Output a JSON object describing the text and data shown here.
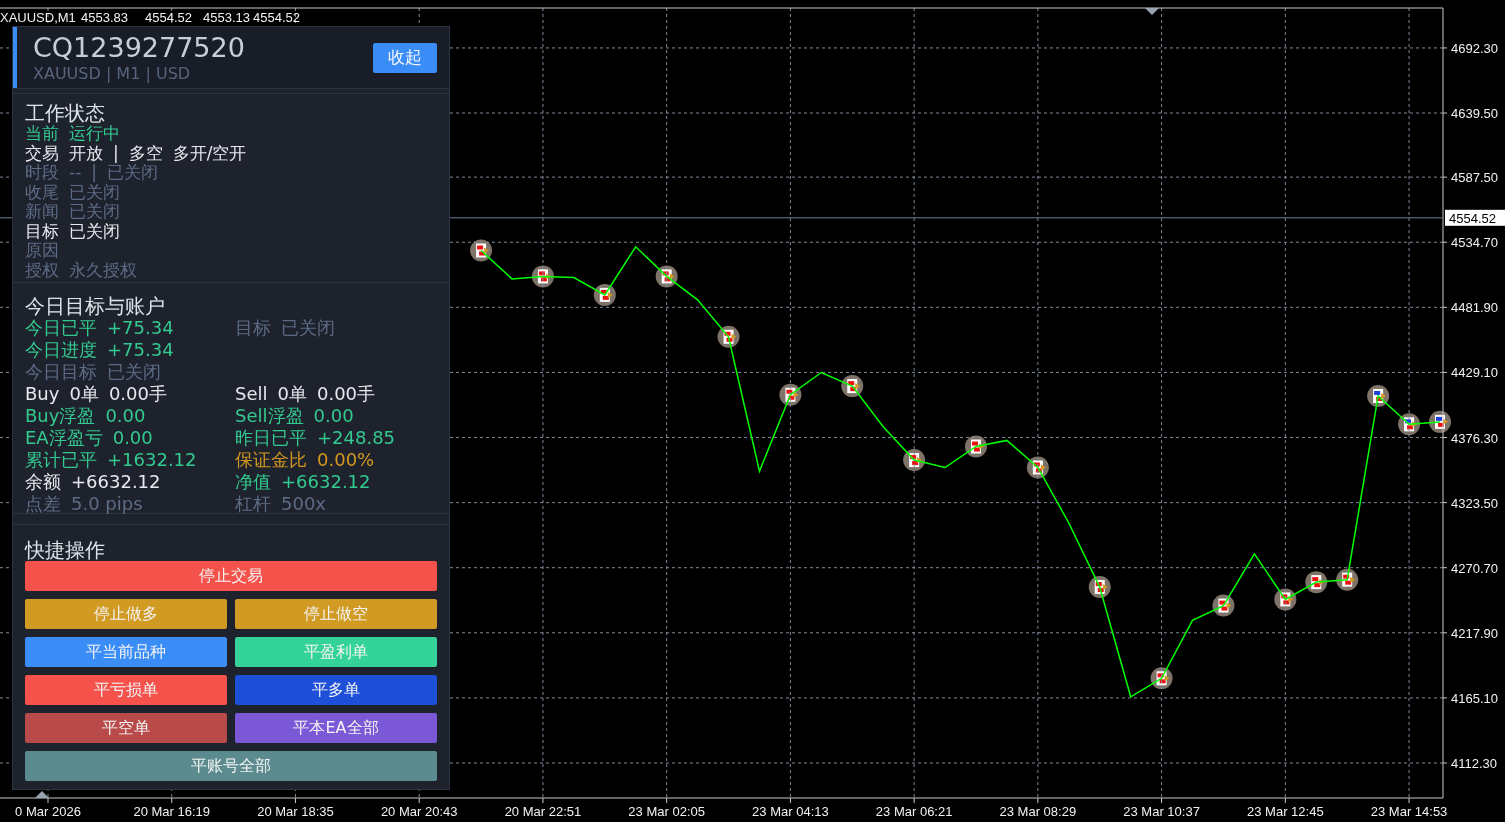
{
  "chart_header": {
    "quotes": [
      "4553.83",
      "4554.52",
      "4553.13",
      "4554.52"
    ]
  },
  "chart_data": {
    "type": "line",
    "grid": true,
    "ylim": [
      4083.9,
      4724.7
    ],
    "categories": [
      "0 Mar 2026",
      null,
      null,
      null,
      "20 Mar 16:19",
      null,
      null,
      null,
      "20 Mar 18:35",
      null,
      null,
      null,
      "20 Mar 20:43",
      null,
      null,
      null,
      "20 Mar 22:51",
      null,
      null,
      null,
      "23 Mar 02:05",
      null,
      null,
      null,
      "23 Mar 04:13",
      null,
      null,
      null,
      "23 Mar 06:21",
      null,
      null,
      null,
      "23 Mar 08:29",
      null,
      null,
      null,
      "23 Mar 10:37",
      null,
      null,
      null,
      "23 Mar 12:45",
      null,
      null,
      null,
      "23 Mar 14:53",
      null
    ],
    "yticks": [
      {
        "value": 4692.3,
        "label": "4692.30"
      },
      {
        "value": 4639.5,
        "label": "4639.50"
      },
      {
        "value": 4587.5,
        "label": "4587.50"
      },
      {
        "value": 4534.7,
        "label": "4534.70"
      },
      {
        "value": 4481.9,
        "label": "4481.90"
      },
      {
        "value": 4429.1,
        "label": "4429.10"
      },
      {
        "value": 4376.3,
        "label": "4376.30"
      },
      {
        "value": 4323.5,
        "label": "4323.50"
      },
      {
        "value": 4270.7,
        "label": "4270.70"
      },
      {
        "value": 4217.9,
        "label": "4217.90"
      },
      {
        "value": 4165.1,
        "label": "4165.10"
      },
      {
        "value": 4112.3,
        "label": "4112.30"
      }
    ],
    "series": [
      {
        "name": "XAUUSD,M1",
        "color": "#00ff00",
        "values": [
          null,
          null,
          null,
          null,
          null,
          null,
          null,
          null,
          null,
          null,
          null,
          null,
          null,
          null,
          4528,
          4505,
          4507,
          4506,
          4492,
          4531,
          4507,
          4488,
          4458,
          4349,
          4411,
          4429,
          4418,
          4385,
          4358,
          4352,
          4369,
          4374,
          4352,
          4307,
          4255,
          4166,
          4181,
          4228,
          4240,
          4282,
          4245,
          4259,
          4261,
          4410,
          4387,
          4389
        ]
      }
    ]
  },
  "current_price": {
    "label": "4554.52"
  },
  "panel": {
    "title": "CQ1239277520",
    "subtitle": "XAUUSD | M1 | USD",
    "collapse_button": "收起",
    "status": {
      "heading": "工作状态",
      "rows": [
        {
          "label": "当前",
          "values": [
            "运行中"
          ],
          "color": "#34c98e"
        },
        {
          "label": "交易",
          "values": [
            "开放",
            "|",
            "多空",
            "多开/空开"
          ],
          "color": "#e6e9ee"
        },
        {
          "label": "时段",
          "values": [
            "--",
            "|",
            "已关闭"
          ],
          "color": "#5d6b85"
        },
        {
          "label": "收尾",
          "values": [
            "已关闭"
          ],
          "color": "#5d6b85"
        },
        {
          "label": "新闻",
          "values": [
            "已关闭"
          ],
          "color": "#5d6b85"
        },
        {
          "label": "目标",
          "values": [
            "已关闭"
          ],
          "color": "#e6e9ee"
        },
        {
          "label": "原因",
          "values": [],
          "color": "#5d6b85"
        },
        {
          "label": "授权",
          "values": [
            "永久授权"
          ],
          "color": "#5d6b85"
        }
      ]
    },
    "account": {
      "heading": "今日目标与账户",
      "rows": [
        {
          "left": {
            "label": "今日已平",
            "values": [
              "+75.34"
            ],
            "color": "#34c98e"
          },
          "right": {
            "label": "目标",
            "values": [
              "已关闭"
            ],
            "color": "#5d6b85"
          }
        },
        {
          "left": {
            "label": "今日进度",
            "values": [
              "+75.34"
            ],
            "color": "#34c98e"
          }
        },
        {
          "left": {
            "label": "今日目标",
            "values": [
              "已关闭"
            ],
            "color": "#5d6b85"
          }
        },
        {
          "left": {
            "label": "Buy",
            "values": [
              "0单",
              "0.00手"
            ],
            "color": "#e6e9ee"
          },
          "right": {
            "label": "Sell",
            "values": [
              "0单",
              "0.00手"
            ],
            "color": "#e6e9ee"
          }
        },
        {
          "left": {
            "label": "Buy浮盈",
            "values": [
              "0.00"
            ],
            "color": "#34c98e"
          },
          "right": {
            "label": "Sell浮盈",
            "values": [
              "0.00"
            ],
            "color": "#34c98e"
          }
        },
        {
          "left": {
            "label": "EA浮盈亏",
            "values": [
              "0.00"
            ],
            "color": "#34c98e"
          },
          "right": {
            "label": "昨日已平",
            "values": [
              "+248.85"
            ],
            "color": "#34c98e"
          }
        },
        {
          "left": {
            "label": "累计已平",
            "values": [
              "+1632.12"
            ],
            "color": "#34c98e"
          },
          "right": {
            "label": "保证金比",
            "values": [
              "0.00%"
            ],
            "color": "#d4981f"
          }
        },
        {
          "left": {
            "label": "余额",
            "values": [
              "+6632.12"
            ],
            "color": "#e6e9ee"
          },
          "right": {
            "label": "净值",
            "values": [
              "+6632.12"
            ],
            "color": "#34c98e"
          }
        },
        {
          "left": {
            "label": "点差",
            "values": [
              "5.0 pips"
            ],
            "color": "#5d6b85"
          },
          "right": {
            "label": "杠杆",
            "values": [
              "500x"
            ],
            "color": "#5d6b85"
          }
        }
      ]
    },
    "actions": {
      "heading": "快捷操作",
      "rows": [
        [
          {
            "label": "停止交易",
            "color": "#f5524c"
          }
        ],
        [
          {
            "label": "停止做多",
            "color": "#d19a22"
          },
          {
            "label": "停止做空",
            "color": "#d19a22"
          }
        ],
        [
          {
            "label": "平当前品种",
            "color": "#3a8cf7"
          },
          {
            "label": "平盈利单",
            "color": "#34d399"
          }
        ],
        [
          {
            "label": "平亏损单",
            "color": "#f5524c"
          },
          {
            "label": "平多单",
            "color": "#1d4fd8"
          }
        ],
        [
          {
            "label": "平空单",
            "color": "#b84b4a"
          },
          {
            "label": "平本EA全部",
            "color": "#7b58d6"
          }
        ],
        [
          {
            "label": "平账号全部",
            "color": "#5b8b8e"
          }
        ]
      ]
    }
  }
}
